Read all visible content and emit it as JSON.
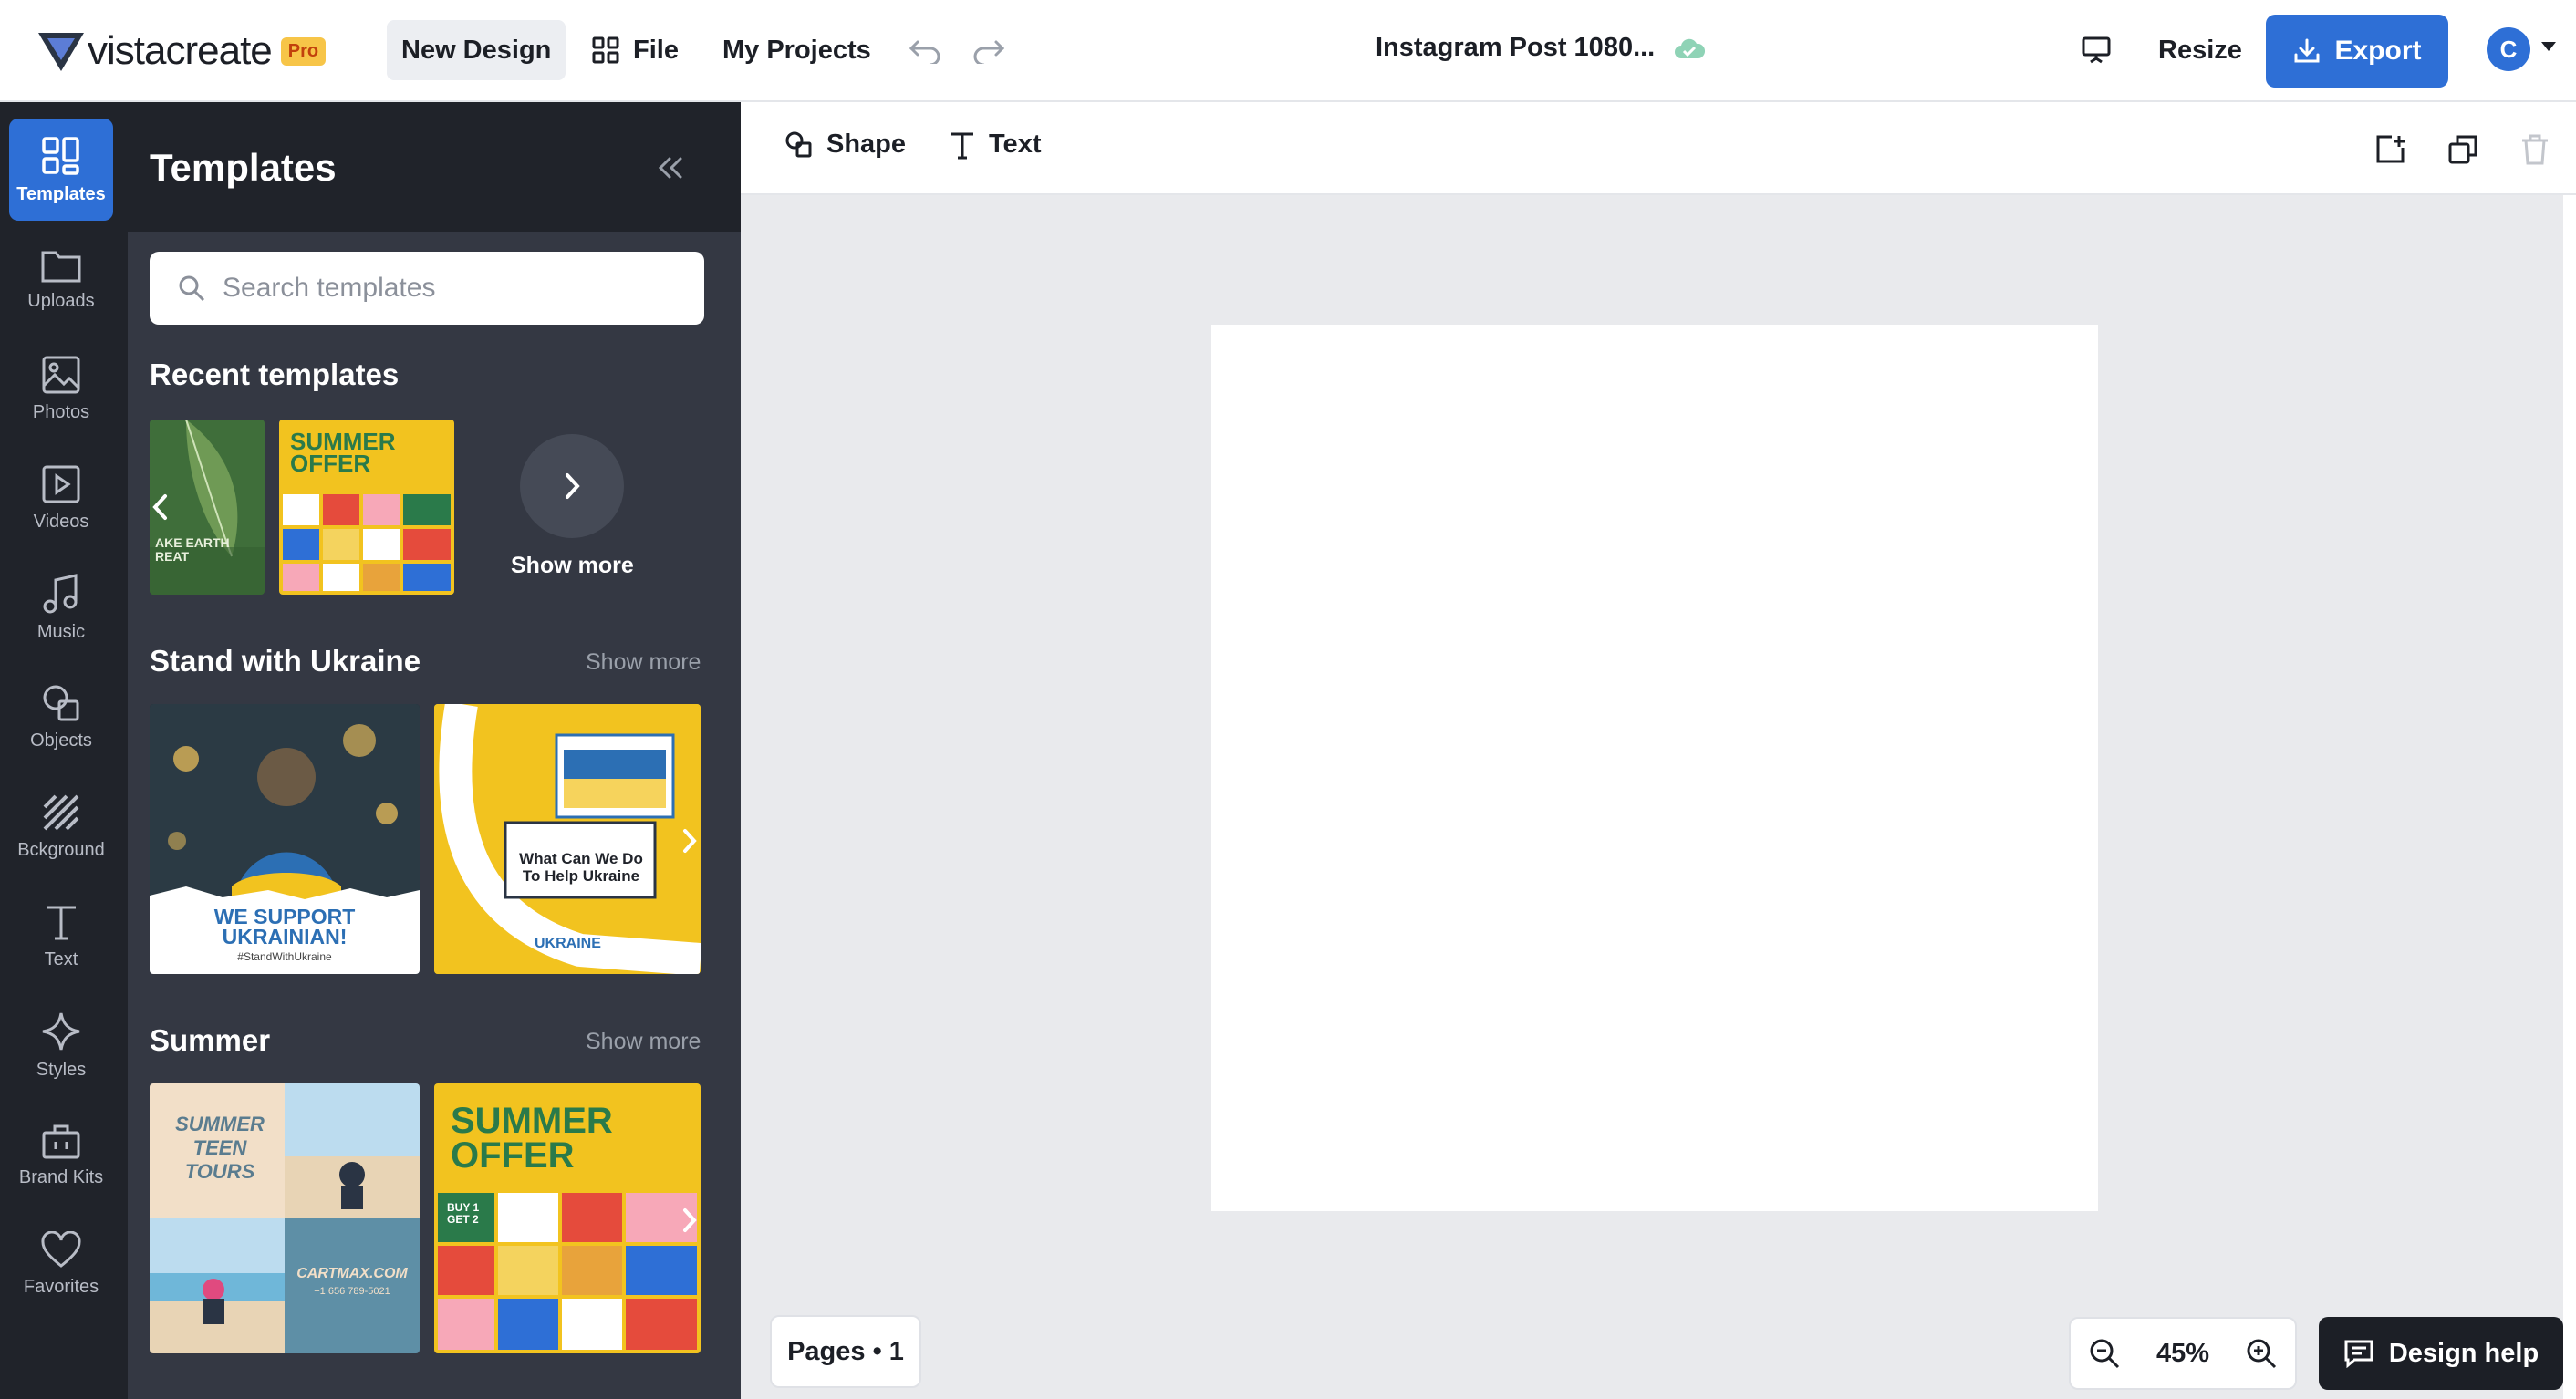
{
  "topbar": {
    "logo_text": "vistacreate",
    "logo_badge": "Pro",
    "new_design": "New Design",
    "file": "File",
    "my_projects": "My Projects",
    "doc_title": "Instagram Post 1080...",
    "resize": "Resize",
    "export": "Export",
    "avatar_initial": "C"
  },
  "rail": {
    "items": [
      {
        "label": "Templates",
        "icon": "templates-icon",
        "active": true
      },
      {
        "label": "Uploads",
        "icon": "folder-icon"
      },
      {
        "label": "Photos",
        "icon": "image-icon"
      },
      {
        "label": "Videos",
        "icon": "play-icon"
      },
      {
        "label": "Music",
        "icon": "music-note-icon"
      },
      {
        "label": "Objects",
        "icon": "objects-icon"
      },
      {
        "label": "Bckground",
        "icon": "hatched-square-icon"
      },
      {
        "label": "Text",
        "icon": "text-t-icon"
      },
      {
        "label": "Styles",
        "icon": "sparkle-icon"
      },
      {
        "label": "Brand Kits",
        "icon": "briefcase-icon"
      },
      {
        "label": "Favorites",
        "icon": "heart-icon"
      }
    ]
  },
  "panel": {
    "title": "Templates",
    "search_placeholder": "Search templates",
    "recent_title": "Recent templates",
    "recent_thumb1_text": "AKE EARTH\nREAT",
    "recent_thumb2_text": "SUMMER\nOFFER",
    "show_more_label": "Show more",
    "ukraine_title": "Stand with Ukraine",
    "ukraine_more": "Show more",
    "ukraine_thumb1_text": "WE SUPPORT\nUKRAINIAN!",
    "ukraine_thumb1_tag": "#StandWithUkraine",
    "ukraine_thumb2_text": "What Can We Do\nTo Help Ukraine",
    "ukraine_thumb2_ring": "UKRAINE",
    "summer_title": "Summer",
    "summer_more": "Show more",
    "summer_thumb1_text": "SUMMER\nTEEN\nTOURS",
    "summer_thumb1_site": "CARTMAX.COM",
    "summer_thumb1_phone": "+1 656 789-5021",
    "summer_thumb2_text": "SUMMER\nOFFER",
    "summer_thumb2_badge": "BUY 1\nGET 2"
  },
  "toolbar": {
    "shape": "Shape",
    "text": "Text"
  },
  "footer": {
    "pages": "Pages • 1",
    "zoom": "45%",
    "design_help": "Design help"
  },
  "colors": {
    "accent": "#2e6fd6",
    "rail_bg": "#20232a",
    "panel_bg": "#343843",
    "stage_bg": "#e9eaed",
    "summer_yellow": "#f2c31f",
    "summer_green": "#2a7a4a"
  }
}
